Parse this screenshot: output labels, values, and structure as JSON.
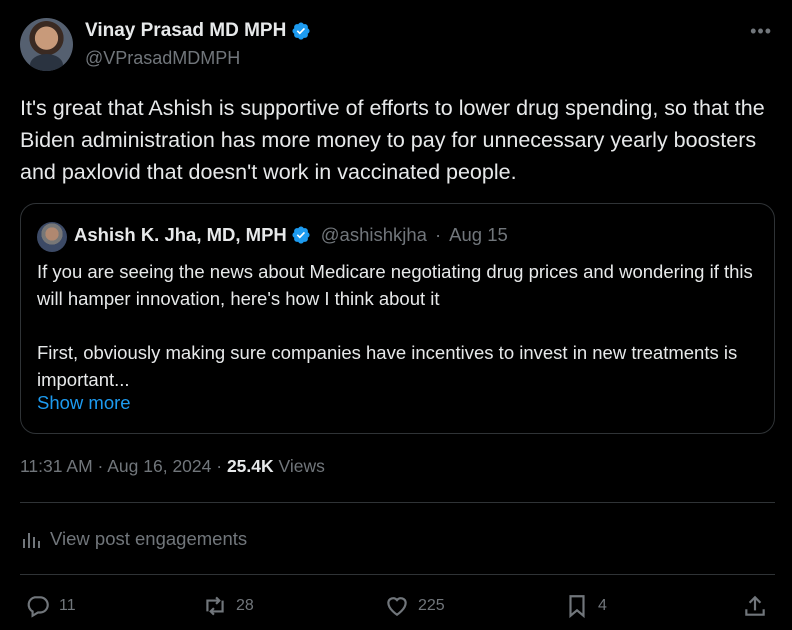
{
  "author": {
    "name": "Vinay Prasad MD MPH",
    "handle": "@VPrasadMDMPH"
  },
  "tweet": {
    "text": "It's great that Ashish is supportive of efforts to lower drug spending, so that the Biden administration has more money to pay for unnecessary yearly boosters and paxlovid that doesn't work in vaccinated people."
  },
  "quote": {
    "name": "Ashish K. Jha, MD, MPH",
    "handle": "@ashishkjha",
    "separator": "·",
    "date": "Aug 15",
    "text": "If you are seeing the news about Medicare negotiating drug prices and wondering if this will hamper innovation, here's how I think about it\n\nFirst, obviously making sure companies have incentives to invest in new treatments is important...",
    "show_more": "Show more"
  },
  "meta": {
    "time": "11:31 AM",
    "sep1": "·",
    "date": "Aug 16, 2024",
    "sep2": "·",
    "views_count": "25.4K",
    "views_label": "Views"
  },
  "engagements_label": "View post engagements",
  "actions": {
    "replies": "11",
    "reposts": "28",
    "likes": "225",
    "bookmarks": "4"
  },
  "colors": {
    "accent": "#1d9bf0",
    "muted": "#71767b",
    "text": "#e7e9ea",
    "background": "#000000",
    "border": "#2f3336"
  },
  "icons": [
    "verified-badge-icon",
    "more-options-icon",
    "analytics-icon",
    "reply-icon",
    "repost-icon",
    "like-icon",
    "bookmark-icon",
    "share-icon"
  ]
}
